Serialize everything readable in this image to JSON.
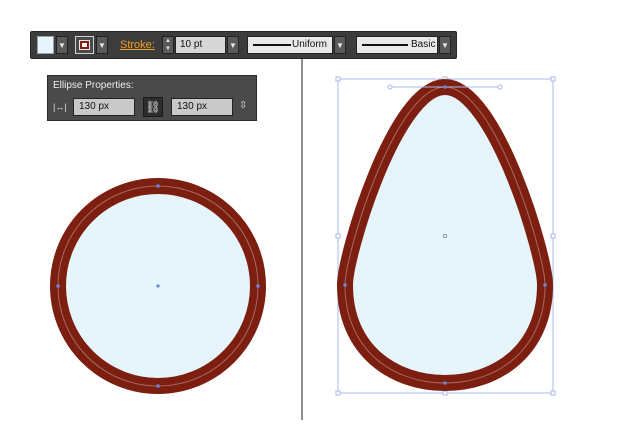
{
  "control_bar": {
    "fill_color": "#e6f4fc",
    "stroke_color": "#8a1e0f",
    "stroke_label": "Stroke:",
    "stroke_weight": "10 pt",
    "variable_width_profile": "Uniform",
    "brush_definition": "Basic",
    "label_color": "#f39c1f"
  },
  "ellipse_panel": {
    "title": "Ellipse Properties:",
    "width": "130 px",
    "height": "130 px",
    "constrain_icon": "link-icon"
  },
  "colors": {
    "fill": "#e6f4fc",
    "stroke": "#7d1f10",
    "selection": "#6d84d8",
    "bounding_box": "#a9b8e8"
  }
}
